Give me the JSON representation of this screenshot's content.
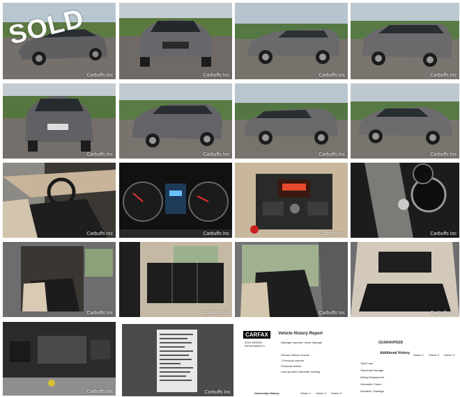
{
  "watermark": "Carbuffs Inc",
  "sold_stamp": "SOLD",
  "carfax": {
    "logo": "CARFAX",
    "report_title": "Vehicle History Report",
    "vehicle": "2013 NISSAN PATHFINDER S",
    "items": [
      "Damage reported: minor damage",
      "1 Previous owners",
      "Service history records",
      "Personal vehicle",
      "Last reported odometer reading"
    ],
    "ownership_label": "Ownership History",
    "guaranteed_label": "GUARANTEED",
    "additional_label": "Additional History",
    "owner_cols": [
      "Owner 1",
      "Owner 2",
      "Owner 3"
    ],
    "check_rows": [
      "Total Loss",
      "Structural Damage",
      "Airbag Deployment",
      "Odometer Check",
      "Accident / Damage"
    ]
  }
}
